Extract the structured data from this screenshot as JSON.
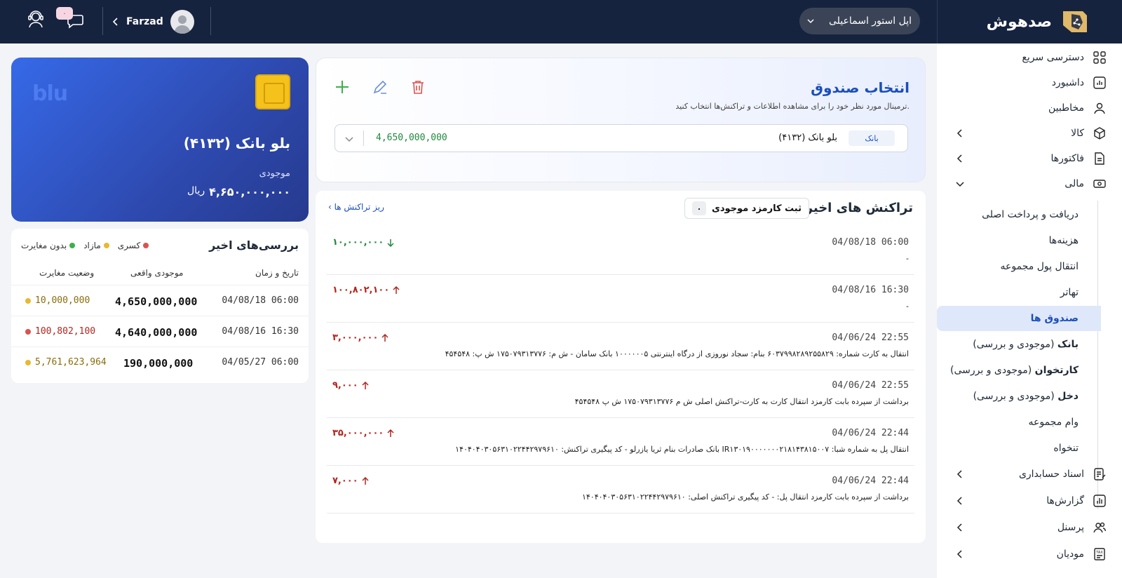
{
  "header": {
    "brand": "صدهوش",
    "store": "اپل استور اسماعیلی",
    "user_name": "Farzad",
    "notif_badge": "۰"
  },
  "sidebar": {
    "items": [
      {
        "label": "دسترسی سریع",
        "icon": "grid-icon"
      },
      {
        "label": "داشبورد",
        "icon": "chart-icon"
      },
      {
        "label": "مخاطبین",
        "icon": "person-icon"
      },
      {
        "label": "کالا",
        "icon": "box-icon"
      },
      {
        "label": "فاکتورها",
        "icon": "invoice-icon"
      },
      {
        "label": "مالی",
        "icon": "cash-icon"
      },
      {
        "label": "اسناد حسابداری",
        "icon": "document-icon"
      },
      {
        "label": "گزارش‌ها",
        "icon": "report-icon"
      },
      {
        "label": "پرسنل",
        "icon": "people-icon"
      },
      {
        "label": "مودیان",
        "icon": "tax-icon"
      }
    ],
    "finance_sub": [
      "دریافت و پرداخت اصلی",
      "هزینه‌ها",
      "انتقال پول مجموعه",
      "تهاتر",
      "صندوق ها"
    ],
    "fund_sub": [
      {
        "bold": "بانک",
        "rest": " (موجودی و بررسی)"
      },
      {
        "bold": "کارتخوان",
        "rest": " (موجودی و بررسی)"
      },
      {
        "bold": "دخل",
        "rest": " (موجودی و بررسی)"
      }
    ],
    "finance_sub2": [
      "وام مجموعه",
      "تنخواه"
    ]
  },
  "card": {
    "logo": "blu",
    "name": "بلو بانک (۴۱۳۲)",
    "balance_label": "موجودی",
    "balance": "۴,۶۵۰,۰۰۰,۰۰۰",
    "currency": "ریال"
  },
  "reviews": {
    "title": "بررسی‌های اخیر",
    "legend": [
      {
        "label": "کسری",
        "color": "#d9534f"
      },
      {
        "label": "مازاد",
        "color": "#e8b931"
      },
      {
        "label": "بدون مغایرت",
        "color": "#3db04a"
      }
    ],
    "columns": [
      "تاریخ و زمان",
      "موجودی واقعی",
      "وضعیت مغایرت"
    ],
    "rows": [
      {
        "date": "04/08/18 06:00",
        "real": "4,650,000,000",
        "diff": "10,000,000",
        "color": "#e8b931",
        "text_color": "#8a6d0b"
      },
      {
        "date": "04/08/16 16:30",
        "real": "4,640,000,000",
        "diff": "100,802,100",
        "color": "#d9534f",
        "text_color": "#b3261e"
      },
      {
        "date": "04/05/27 06:00",
        "real": "190,000,000",
        "diff": "5,761,623,964",
        "color": "#e8b931",
        "text_color": "#8a6d0b"
      }
    ]
  },
  "fund": {
    "title": "انتخاب صندوق",
    "subtitle": "ترمینال مورد نظر خود را برای مشاهده اطلاعات و تراکنش‌ها انتخاب کنید.",
    "tag": "بانک",
    "selected_name": "بلو بانک (۴۱۳۲)",
    "selected_amount": "4,650,000,000"
  },
  "transactions": {
    "title": "تراکنش های اخیر",
    "fee_button": "ثبت کارمزد موجودی",
    "fee_count": "۰",
    "details_link": "ریز تراکنش ها",
    "rows": [
      {
        "date": "04/08/18 06:00",
        "desc": "-",
        "amount": "۱۰,۰۰۰,۰۰۰",
        "dir": "in"
      },
      {
        "date": "04/08/16 16:30",
        "desc": "-",
        "amount": "۱۰۰,۸۰۲,۱۰۰",
        "dir": "out"
      },
      {
        "date": "04/06/24 22:55",
        "desc": "انتقال به کارت شماره: ۶۰۳۷۹۹۸۲۸۹۲۵۵۸۲۹ بنام: سجاد نوروزی از درگاه اینترنتی ۱۰۰۰۰۰۰۵ بانک سامان - ش م: ۱۷۵۰۷۹۳۱۳۷۷۶ ش پ: ۴۵۴۵۴۸",
        "amount": "۳,۰۰۰,۰۰۰",
        "dir": "out"
      },
      {
        "date": "04/06/24 22:55",
        "desc": "برداشت از سپرده بابت کارمزد انتقال کارت به کارت-تراکنش اصلی ش م ۱۷۵۰۷۹۳۱۳۷۷۶ ش پ ۴۵۴۵۴۸",
        "amount": "۹,۰۰۰",
        "dir": "out"
      },
      {
        "date": "04/06/24 22:44",
        "desc": "انتقال پل به شماره شبا: IR۱۳۰۱۹۰۰۰۰۰۰۰۲۱۸۱۴۳۸۱۵۰۰۷ بانک صادرات بنام ثریا یازرلو - کد پیگیری تراکنش: ۱۴۰۴۰۴۰۳۰۵۶۳۱۰۲۲۴۴۲۹۷۹۶۱۰",
        "amount": "۳۵,۰۰۰,۰۰۰",
        "dir": "out"
      },
      {
        "date": "04/06/24 22:44",
        "desc": "برداشت از سپرده بابت کارمزد انتقال پل: - کد پیگیری تراکنش اصلی: ۱۴۰۴۰۴۰۳۰۵۶۳۱۰۲۲۴۴۲۹۷۹۶۱۰",
        "amount": "۷,۰۰۰",
        "dir": "out"
      }
    ]
  }
}
